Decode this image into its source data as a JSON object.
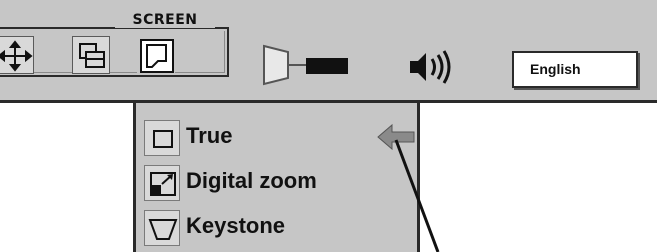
{
  "menubar": {
    "group_title": "SCREEN",
    "buttons": [
      {
        "name": "move",
        "icon": "move-arrows-icon"
      },
      {
        "name": "screen",
        "icon": "screen-overlap-icon"
      },
      {
        "name": "size",
        "icon": "keystone-screen-icon"
      }
    ],
    "other_icons": [
      "keystone-ghost-icon",
      "projector-icon",
      "speaker-volume-icon"
    ],
    "language_value": "English"
  },
  "submenu": {
    "items": [
      {
        "label": "True",
        "icon": "true-square-icon"
      },
      {
        "label": "Digital zoom",
        "icon": "digital-zoom-icon"
      },
      {
        "label": "Keystone",
        "icon": "keystone-icon"
      }
    ],
    "pointer_icon": "left-arrow-icon"
  },
  "colors": {
    "menu_bg": "#c6c6c6",
    "border": "#2a2a2a"
  }
}
